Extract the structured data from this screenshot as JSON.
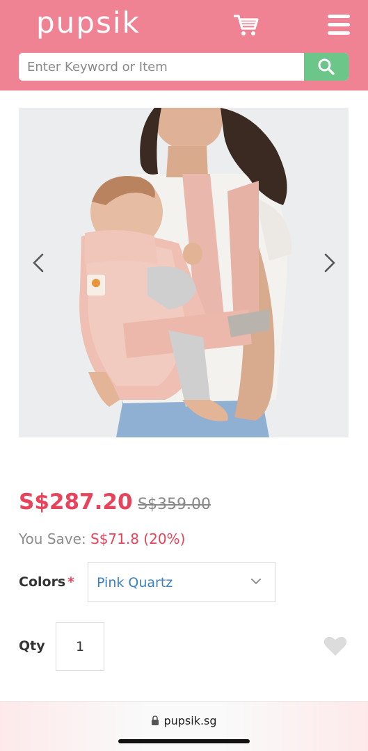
{
  "header": {
    "logo": "pupsik",
    "cart_icon": "cart-icon",
    "menu_icon": "hamburger-menu-icon",
    "background_color": "#ef8293"
  },
  "search": {
    "placeholder": "Enter Keyword or Item",
    "button_icon": "search-icon",
    "button_color": "#6cc68a"
  },
  "product": {
    "image_alt": "Woman wearing a pink quartz baby carrier with infant",
    "prev_icon": "chevron-left-icon",
    "next_icon": "chevron-right-icon",
    "price": "S$287.20",
    "old_price": "S$359.00",
    "you_save_label": "You Save:",
    "you_save_value": "S$71.8 (20%)",
    "accent_color": "#e8435a"
  },
  "options": {
    "colors_label": "Colors",
    "required_mark": "*",
    "colors_selected": "Pink Quartz",
    "qty_label": "Qty",
    "qty_value": "1",
    "wishlist_icon": "heart-icon"
  },
  "browser": {
    "lock_icon": "lock-icon",
    "url": "pupsik.sg"
  }
}
